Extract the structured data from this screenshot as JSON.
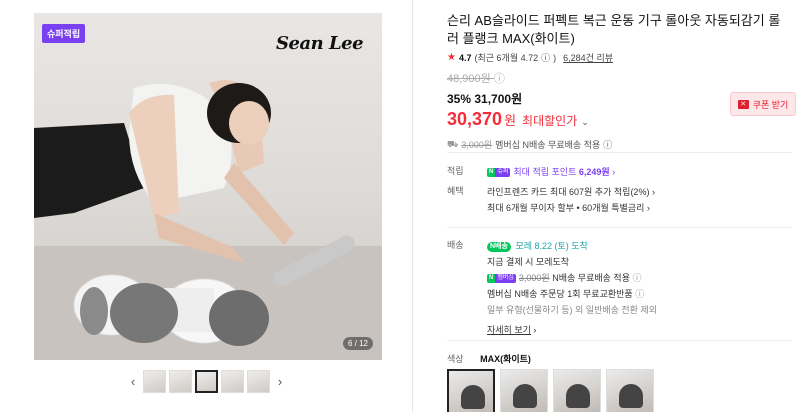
{
  "gallery": {
    "promo_badge": "슈퍼적립",
    "brand_text": "Sean Lee",
    "counter": "6 / 12",
    "prev_arrow": "‹",
    "next_arrow": "›"
  },
  "product": {
    "title": "슨리 AB슬라이드 퍼펙트 복근 운동 기구 롤아웃 자동되감기 롤러 플랭크 MAX(화이트)",
    "rating": "4.7",
    "rating_recent": "(최근 6개월 4.72",
    "rating_recent_close": ")",
    "review_count": "6,284건 리뷰",
    "original_price": "48,900원",
    "discount_percent": "35%",
    "sale_price": "31,700원",
    "final_price": "30,370",
    "final_won": "원",
    "final_label": "최대할인가",
    "coupon_button": "쿠폰 받기",
    "ship_strike": "3,000원",
    "ship_note": "멤버십 N배송 무료배송 적용"
  },
  "points": {
    "label": "적립",
    "n_badge": "N",
    "plus_badge": "슈퍼",
    "text": "최대 적립 포인트",
    "amount": "6,249원"
  },
  "benefits": {
    "label": "혜택",
    "line1": "라인프렌즈 카드 최대 607원 추가 적립(2%)",
    "line2": "최대 6개월 무이자 할부 • 60개월 특별금리"
  },
  "delivery": {
    "label": "배송",
    "badge": "N배송",
    "arrival": "모레 8.22 (토) 도착",
    "line2": "지금 결제 시 모레도착",
    "member_badge_n": "N",
    "member_badge_p": "멤버십",
    "strike": "3,000원",
    "member_text": "N배송 무료배송 적용",
    "line4": "멤버십 N배송 주문당 1회 무료교환반품",
    "line5": "일부 유형(선물하기 등) 외 일반배송 전환 제외",
    "more": "자세히 보기"
  },
  "option": {
    "label": "색상",
    "value": "MAX(화이트)"
  },
  "colors": {
    "accent": "#f52d3a",
    "purple": "#7b3ff2",
    "green": "#03c75a"
  }
}
